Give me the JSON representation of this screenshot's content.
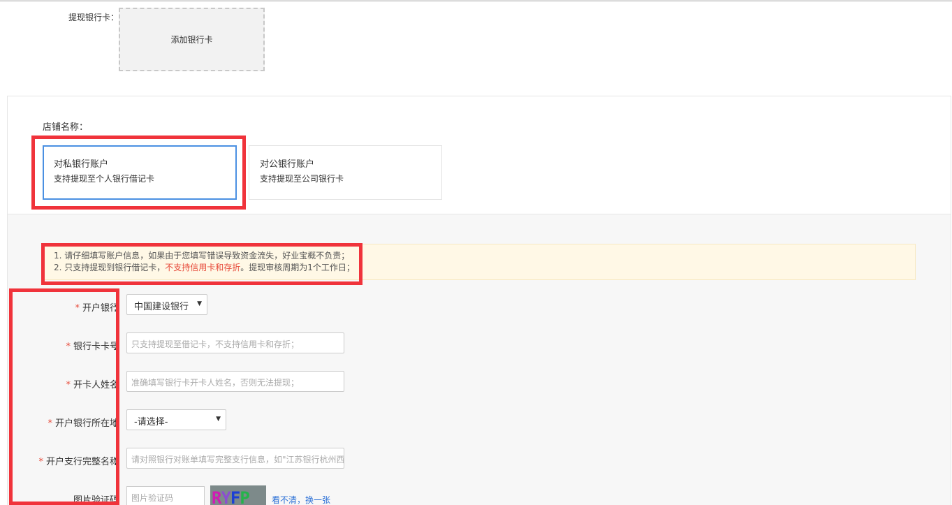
{
  "withdraw": {
    "label": "提现银行卡：",
    "add_card": "添加银行卡"
  },
  "shop": {
    "label": "店铺名称："
  },
  "accounts": [
    {
      "title": "对私银行账户",
      "desc": "支持提现至个人银行借记卡",
      "selected": true
    },
    {
      "title": "对公银行账户",
      "desc": "支持提现至公司银行卡",
      "selected": false
    }
  ],
  "notice": {
    "line1": "1. 请仔细填写账户信息，如果由于您填写错误导致资金流失，好业宝概不负责；",
    "line2_prefix": "2. 只支持提现到银行借记卡，",
    "line2_red": "不支持信用卡和存折",
    "line2_suffix": "。提现审核周期为1个工作日；"
  },
  "form": {
    "bank": {
      "label": "开户银行",
      "value": "中国建设银行"
    },
    "card_no": {
      "label": "银行卡卡号",
      "placeholder": "只支持提现至借记卡，不支持信用卡和存折；"
    },
    "holder": {
      "label": "开卡人姓名",
      "placeholder": "准确填写银行卡开卡人姓名，否则无法提现；"
    },
    "location": {
      "label": "开户银行所在地",
      "value": "-请选择-"
    },
    "branch": {
      "label": "开户支行完整名称",
      "placeholder": "请对照银行对账单填写完整支行信息，如\"江苏银行杭州西"
    },
    "captcha": {
      "label": "图片验证码",
      "placeholder": "图片验证码",
      "refresh": "看不清，换一张"
    }
  },
  "colon": "：",
  "colors": {
    "highlight": "#f0333b",
    "selected_border": "#4a90e2",
    "link": "#2a6fd6",
    "warning_text": "#e74c3c"
  },
  "icons": {
    "dropdown": "caret-down-icon"
  }
}
